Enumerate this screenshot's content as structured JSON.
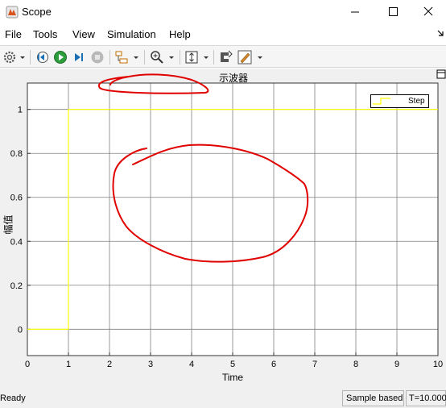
{
  "window": {
    "title": "Scope"
  },
  "menu": {
    "items": [
      "File",
      "Tools",
      "View",
      "Simulation",
      "Help"
    ]
  },
  "toolbar": {
    "icons": [
      "gear-icon",
      "step-back-icon",
      "run-icon",
      "step-forward-icon",
      "stop-icon",
      "signal-selector-icon",
      "zoom-icon",
      "autoscale-icon",
      "highlight-block-icon",
      "style-icon"
    ]
  },
  "plot": {
    "title": "示波器",
    "xlabel": "Time",
    "ylabel": "幅值",
    "legend": [
      "Step"
    ]
  },
  "chart_data": {
    "type": "line",
    "title": "示波器",
    "xlabel": "Time",
    "ylabel": "幅值",
    "xlim": [
      0,
      10
    ],
    "ylim": [
      -0.12,
      1.12
    ],
    "xticks": [
      0,
      1,
      2,
      3,
      4,
      5,
      6,
      7,
      8,
      9,
      10
    ],
    "yticks": [
      0,
      0.2,
      0.4,
      0.6,
      0.8,
      1
    ],
    "grid": true,
    "legend_position": "top-right",
    "series": [
      {
        "name": "Step",
        "color": "#ffff00",
        "x": [
          0,
          1,
          1,
          10
        ],
        "y": [
          0,
          0,
          1,
          1
        ]
      }
    ]
  },
  "status": {
    "text": "Ready",
    "sample": "Sample based",
    "time": "T=10.000"
  },
  "colors": {
    "axes_bg": "#ffffff",
    "grid": "#7f7f7f",
    "trace": "#ffff00",
    "annotation": "#e00000"
  }
}
